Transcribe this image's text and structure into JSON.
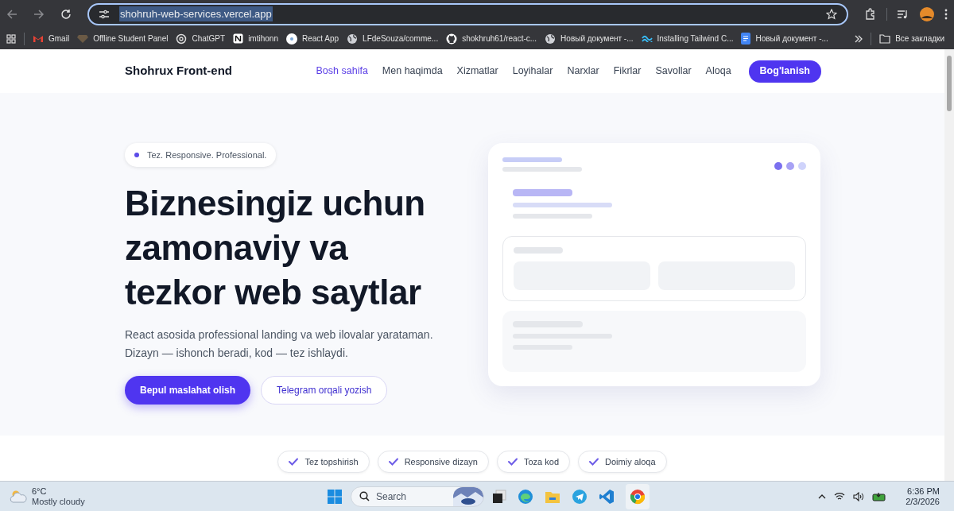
{
  "browser": {
    "url": "shohruh-web-services.vercel.app",
    "bookmarks": [
      {
        "label": "Gmail",
        "kind": "gmail"
      },
      {
        "label": "Offline Student Panel",
        "kind": "diamond"
      },
      {
        "label": "ChatGPT",
        "kind": "chatgpt"
      },
      {
        "label": "imtihonn",
        "kind": "notion"
      },
      {
        "label": "React App",
        "kind": "react"
      },
      {
        "label": "LFdeSouza/comme...",
        "kind": "globe"
      },
      {
        "label": "shokhruh61/react-c...",
        "kind": "github"
      },
      {
        "label": "Новый документ -...",
        "kind": "globe"
      },
      {
        "label": "Installing Tailwind C...",
        "kind": "tailwind"
      },
      {
        "label": "Новый документ -...",
        "kind": "docs"
      }
    ],
    "all_bookmarks": "Все закладки"
  },
  "site": {
    "brand": "Shohrux Front-end",
    "nav": [
      {
        "label": "Bosh sahifa",
        "selected": true
      },
      {
        "label": "Men haqimda",
        "selected": false
      },
      {
        "label": "Xizmatlar",
        "selected": false
      },
      {
        "label": "Loyihalar",
        "selected": false
      },
      {
        "label": "Narxlar",
        "selected": false
      },
      {
        "label": "Fikrlar",
        "selected": false
      },
      {
        "label": "Savollar",
        "selected": false
      },
      {
        "label": "Aloqa",
        "selected": false
      }
    ],
    "nav_cta": "Bog'lanish",
    "badge": "Tez. Responsive. Professional.",
    "headline": [
      "Biznesingiz uchun",
      "zamonaviy va",
      "tezkor web saytlar"
    ],
    "subtitle": [
      "React asosida professional landing va web ilovalar yarataman.",
      "Dizayn — ishonch beradi, kod — tez ishlaydi."
    ],
    "primary_button": "Bepul maslahat olish",
    "secondary_button": "Telegram orqali yozish",
    "features": [
      "Tez topshirish",
      "Responsive dizayn",
      "Toza kod",
      "Doimiy aloqa"
    ]
  },
  "taskbar": {
    "temperature": "6°C",
    "weather": "Mostly cloudy",
    "search_placeholder": "Search",
    "time": "6:36 PM",
    "date": "2/3/2026"
  }
}
